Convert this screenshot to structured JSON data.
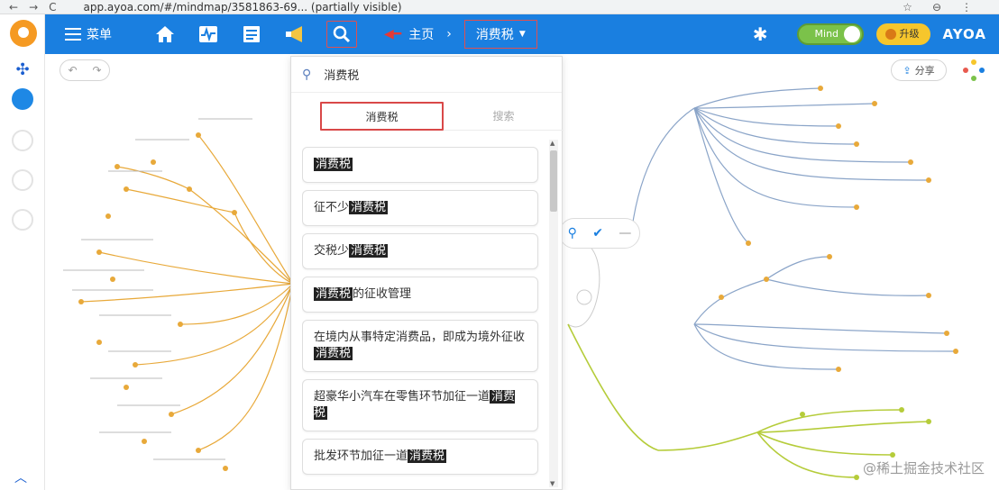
{
  "browser": {
    "nav": [
      "←",
      "→",
      "C"
    ],
    "url": "app.ayoa.com/#/mindmap/3581863-69... (partially visible)",
    "right": [
      "☆",
      "⊖",
      "⋮"
    ]
  },
  "toolbar": {
    "menu_label": "菜单",
    "icons": [
      "home-icon",
      "activity-icon",
      "tasks-icon",
      "megaphone-icon",
      "search-icon"
    ],
    "breadcrumb_parent": "主页",
    "breadcrumb_current": "消费税",
    "toggle_label": "Mind",
    "upgrade_label": "升级",
    "brand": "AYOA"
  },
  "canvas": {
    "share_label": "分享"
  },
  "search": {
    "query": "消费税",
    "tabs": [
      {
        "label": "消费税",
        "active": true
      },
      {
        "label": "搜索",
        "active": false
      }
    ],
    "results": [
      {
        "before": "",
        "match": "消费税",
        "after": ""
      },
      {
        "before": "征不少",
        "match": "消费税",
        "after": ""
      },
      {
        "before": "交税少",
        "match": "消费税",
        "after": ""
      },
      {
        "before": "",
        "match": "消费税",
        "after": "的征收管理"
      },
      {
        "before": "在境内从事特定消费品，即成为境外征收",
        "match": "消费税",
        "after": ""
      },
      {
        "before": "超豪华小汽车在零售环节加征一道",
        "match": "消费税",
        "after": ""
      },
      {
        "before": "批发环节加征一道",
        "match": "消费税",
        "after": ""
      }
    ]
  },
  "watermark": "@稀土掘金技术社区",
  "colors": {
    "toolbar": "#1a7fe0",
    "highlight_border": "#d94848",
    "branch_orange": "#e8a93a",
    "branch_blue": "#8aa4c8",
    "branch_green": "#b5cc3a"
  }
}
